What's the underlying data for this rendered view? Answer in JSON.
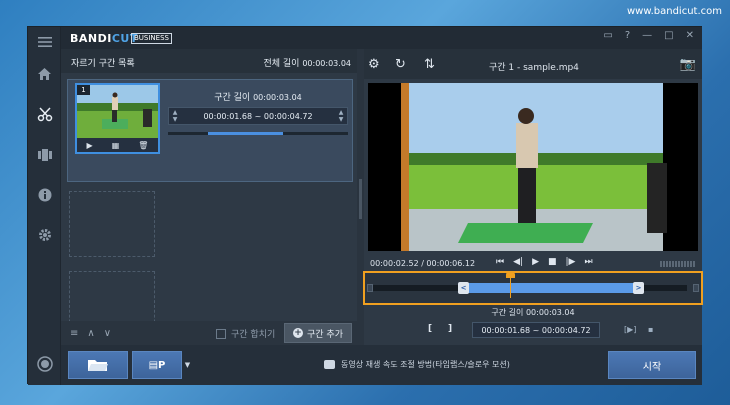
{
  "watermark": "www.bandicut.com",
  "app": {
    "logo_main": "BANDI",
    "logo_accent": "CUT",
    "edition": "BUSINESS"
  },
  "rail": {
    "items": [
      "menu-icon",
      "home-icon",
      "cut-icon",
      "split-icon",
      "info-icon",
      "settings-icon",
      "record-icon"
    ]
  },
  "segments": {
    "header_title": "자르기 구간 목록",
    "total_label": "전체 길이",
    "total_value": "00:00:03.04",
    "card": {
      "number": "1",
      "length_label": "구간 길이",
      "length_value": "00:00:03.04",
      "start": "00:00:01.68",
      "sep": "~",
      "end": "00:00:04.72"
    },
    "merge_label": "구간 합치기",
    "add_label": "구간 추가"
  },
  "player": {
    "title": "구간 1 - sample.mp4",
    "timecode": "00:00:02.52 / 00:00:06.12",
    "length_label": "구간 길이",
    "length_value": "00:00:03.04",
    "start": "00:00:01.68",
    "sep": "~",
    "end": "00:00:04.72"
  },
  "bottom": {
    "format_label": "P",
    "tip": "동영상 재생 속도 조절 방법(타임랩스/슬로우 모션)",
    "start_label": "시작"
  },
  "colors": {
    "accent": "#4fa3e6",
    "highlight": "#f0a020",
    "selection": "#5b9be8"
  }
}
